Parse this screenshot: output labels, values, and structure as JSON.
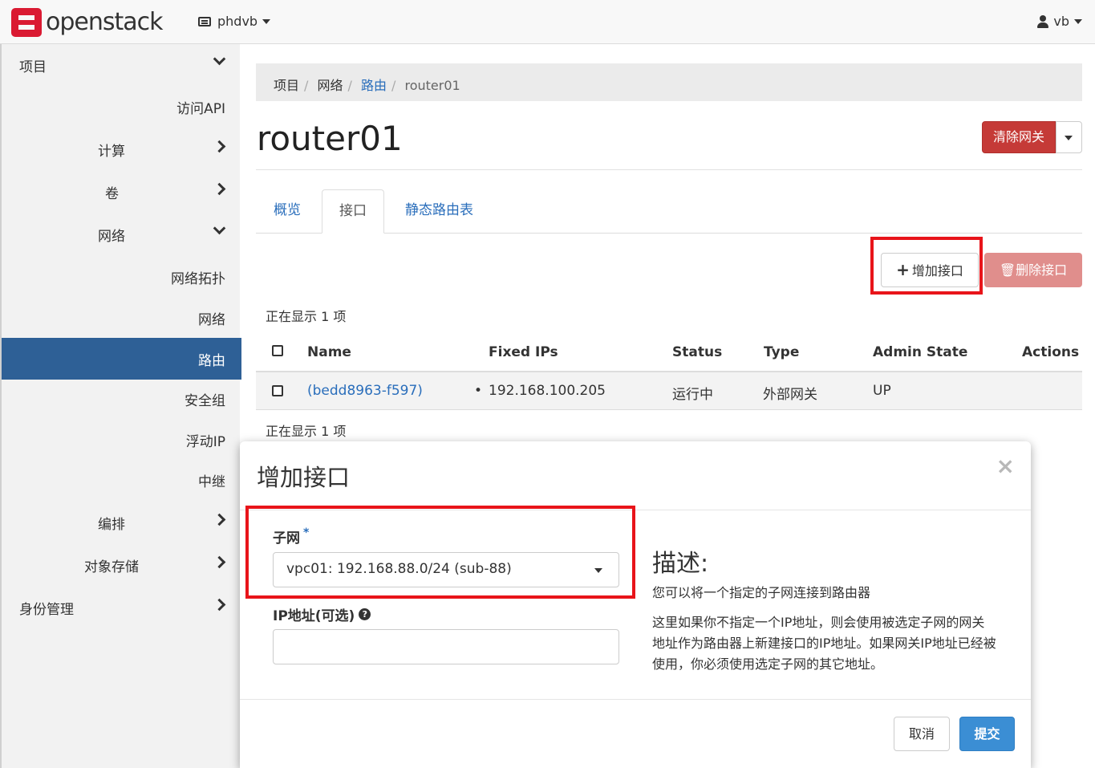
{
  "topbar": {
    "brand": "openstack",
    "project": "phdvb",
    "user": "vb"
  },
  "sidebar": {
    "items": [
      {
        "label": "项目"
      },
      {
        "label": "访问API"
      },
      {
        "label": "计算"
      },
      {
        "label": "卷"
      },
      {
        "label": "网络"
      },
      {
        "label": "网络拓扑"
      },
      {
        "label": "网络"
      },
      {
        "label": "路由"
      },
      {
        "label": "安全组"
      },
      {
        "label": "浮动IP"
      },
      {
        "label": "中继"
      },
      {
        "label": "编排"
      },
      {
        "label": "对象存储"
      },
      {
        "label": "身份管理"
      }
    ]
  },
  "breadcrumb": [
    "项目",
    "网络",
    "路由",
    "router01"
  ],
  "page": {
    "title": "router01",
    "clear_gateway": "清除网关"
  },
  "tabs": [
    "概览",
    "接口",
    "静态路由表"
  ],
  "toolbar": {
    "add_interface": "增加接口",
    "delete_interface": "删除接口"
  },
  "table": {
    "count_label": "正在显示 1 项",
    "columns": [
      "Name",
      "Fixed IPs",
      "Status",
      "Type",
      "Admin State",
      "Actions"
    ],
    "rows": [
      {
        "name": "(bedd8963-f597)",
        "fixed_ip": "192.168.100.205",
        "status": "运行中",
        "type": "外部网关",
        "admin_state": "UP"
      }
    ]
  },
  "modal": {
    "title": "增加接口",
    "close": "×",
    "subnet_label": "子网",
    "required_mark": "*",
    "subnet_value": "vpc01: 192.168.88.0/24 (sub-88)",
    "ip_label": "IP地址(可选)",
    "description_title": "描述:",
    "description_1": "您可以将一个指定的子网连接到路由器",
    "description_2": "这里如果你不指定一个IP地址，则会使用被选定子网的网关地址作为路由器上新建接口的IP地址。如果网关IP地址已经被使用，你必须使用选定子网的其它地址。",
    "cancel": "取消",
    "submit": "提交"
  },
  "colors": {
    "accent": "#2e6096",
    "danger": "#c53a37",
    "primary": "#3b8ed4",
    "highlight": "#e8141a"
  }
}
